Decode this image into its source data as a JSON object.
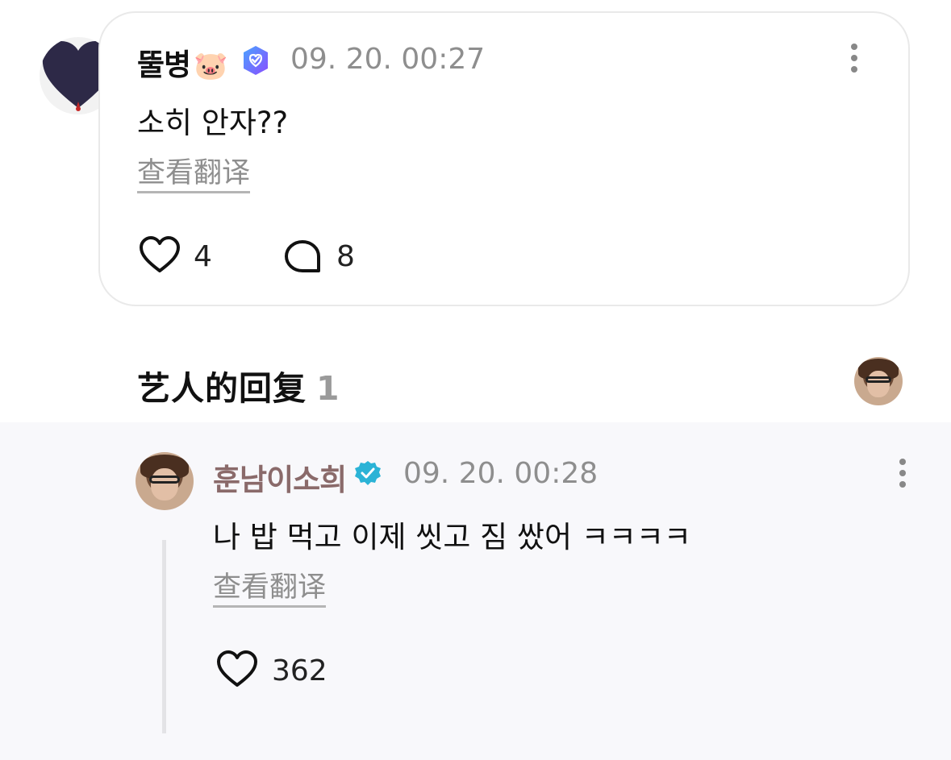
{
  "comment": {
    "author": "뚤병",
    "author_emoji": "🐷",
    "verified_icon": "purple-verified-badge-icon",
    "timestamp": "09. 20. 00:27",
    "text": "소히 안자??",
    "translate_label": "查看翻译",
    "like_count": "4",
    "reply_count": "8"
  },
  "artist_replies": {
    "title": "艺人的回复",
    "count": "1"
  },
  "reply": {
    "author": "훈남이소희",
    "timestamp": "09. 20. 00:28",
    "text": "나 밥 먹고 이제 씻고 짐 쌌어 ㅋㅋㅋㅋ",
    "translate_label": "查看翻译",
    "like_count": "362"
  },
  "colors": {
    "artist_name": "#8a6a6a",
    "verified_teal": "#2bb3d6",
    "badge_purple": "#6e5bff",
    "muted": "#8e8e8e",
    "reply_bg": "#f8f8fb"
  }
}
